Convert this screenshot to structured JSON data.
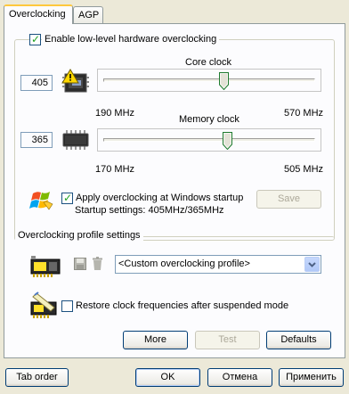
{
  "tabs": [
    {
      "label": "Overclocking",
      "active": true
    },
    {
      "label": "AGP",
      "active": false
    }
  ],
  "enable_overclocking": {
    "label": "Enable low-level hardware overclocking",
    "checked": true
  },
  "core_clock": {
    "title": "Core clock",
    "value": "405",
    "min_label": "190 MHz",
    "max_label": "570 MHz",
    "min": 190,
    "max": 570,
    "current": 405,
    "icon": "gpu-warning-icon"
  },
  "memory_clock": {
    "title": "Memory clock",
    "value": "365",
    "min_label": "170 MHz",
    "max_label": "505 MHz",
    "min": 170,
    "max": 505,
    "current": 365,
    "icon": "memory-chip-icon"
  },
  "startup": {
    "label": "Apply overclocking at Windows startup",
    "checked": true,
    "settings_text": "Startup settings: 405MHz/365MHz",
    "save_label": "Save",
    "icon": "windows-logo-icon"
  },
  "profile": {
    "group_title": "Overclocking profile settings",
    "selected": "<Custom overclocking profile>",
    "icon": "graphics-card-icon"
  },
  "restore": {
    "label": "Restore clock frequencies after suspended mode",
    "checked": false,
    "icon": "suspend-card-icon"
  },
  "panel_buttons": {
    "more": "More",
    "test": "Test",
    "defaults": "Defaults"
  },
  "footer": {
    "tab_order": "Tab order",
    "ok": "OK",
    "cancel": "Отмена",
    "apply": "Применить"
  },
  "colors": {
    "dialog_bg": "#ece9d8",
    "panel_bg": "#fcfcfe",
    "tab_highlight": "#ffc83c",
    "button_border": "#003c74",
    "disabled_text": "#aca899"
  }
}
